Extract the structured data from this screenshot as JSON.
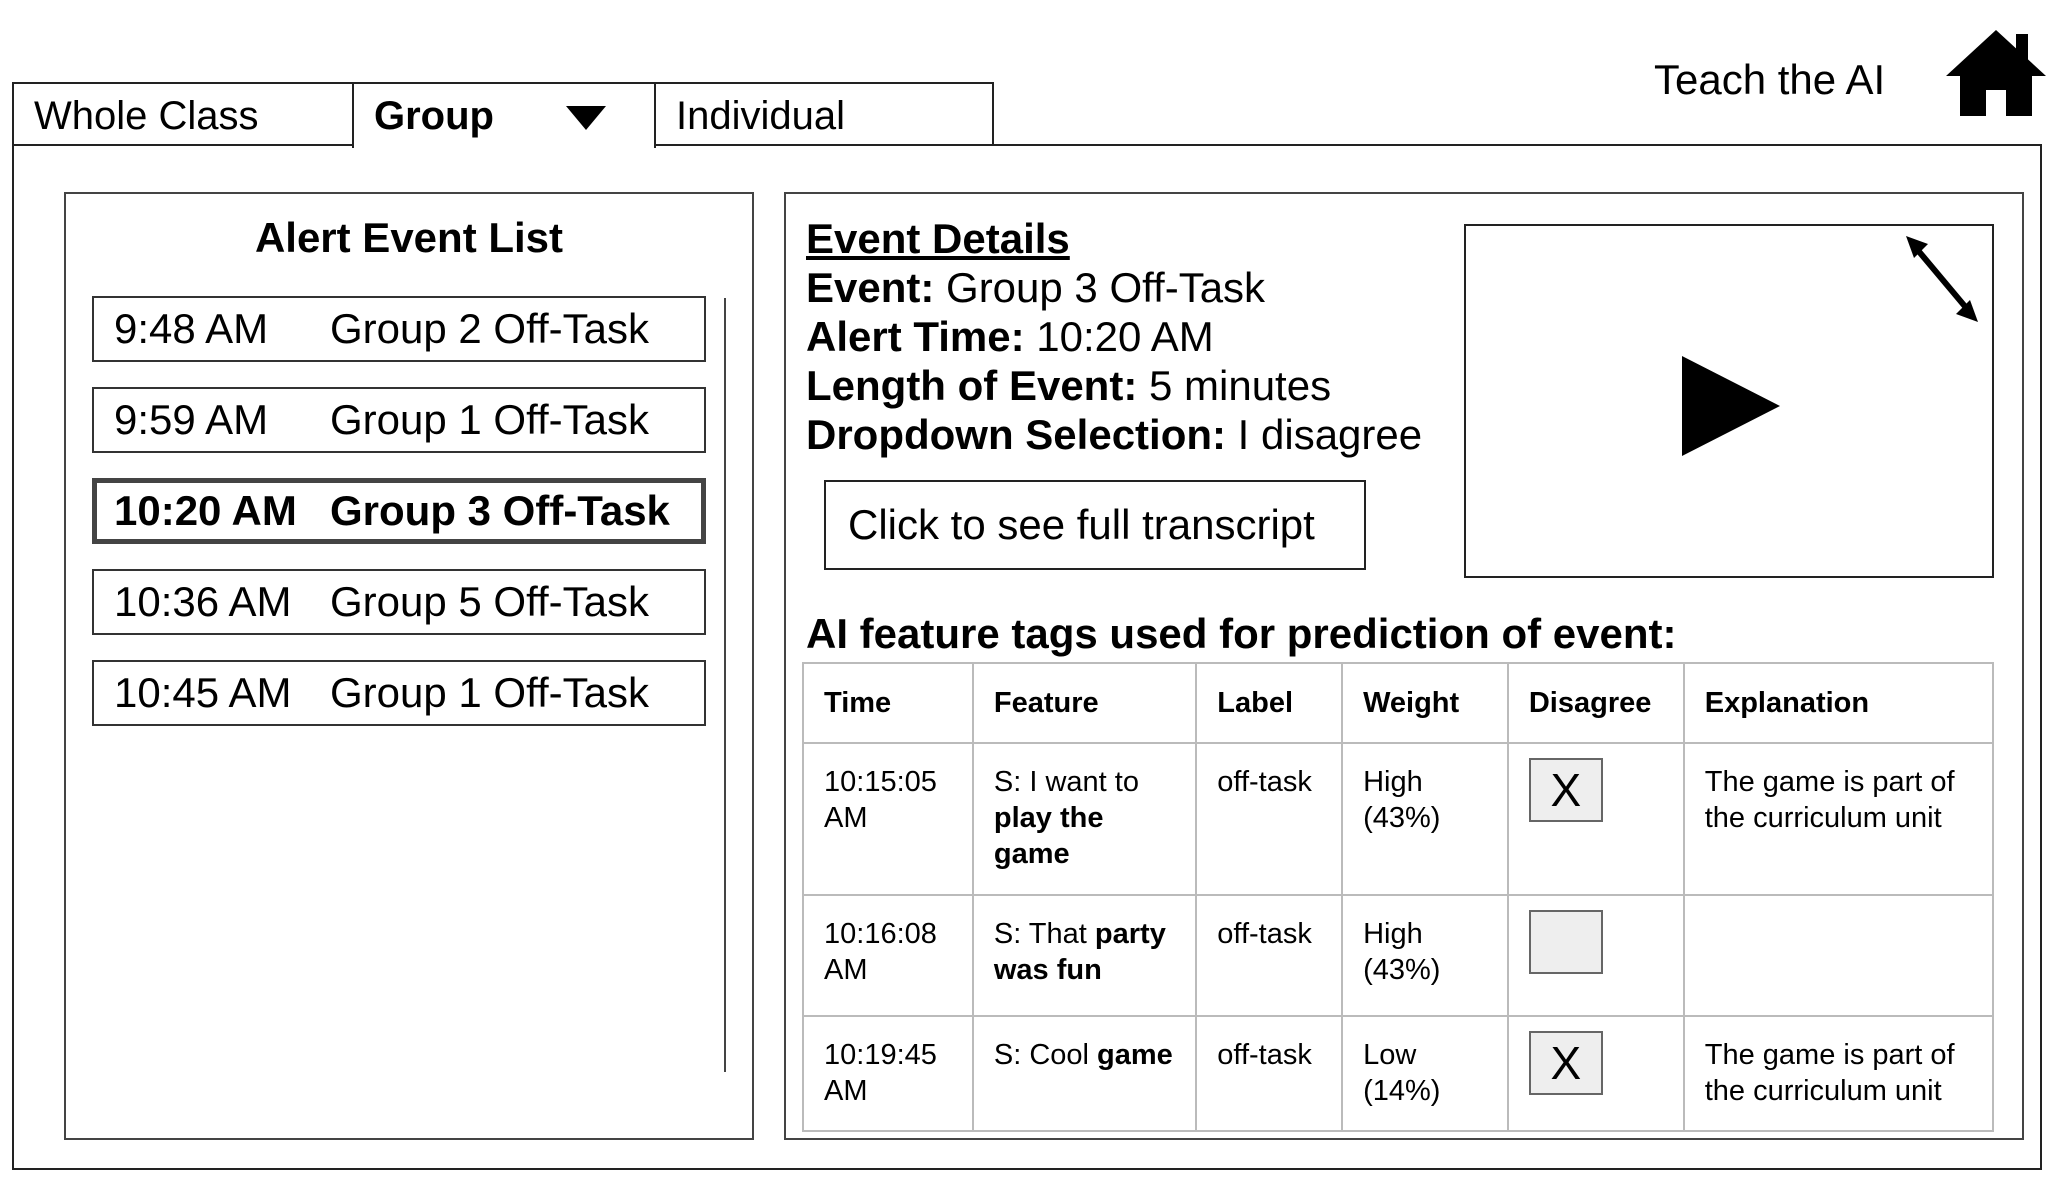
{
  "tabs": [
    {
      "label": "Whole Class",
      "active": false
    },
    {
      "label": "Group",
      "active": true,
      "has_dropdown": true
    },
    {
      "label": "Individual",
      "active": false
    }
  ],
  "header": {
    "title": "Teach  the AI",
    "home_icon": "home-icon"
  },
  "alert_list": {
    "title": "Alert Event List",
    "items": [
      {
        "time": "9:48 AM",
        "name": "Group 2 Off-Task",
        "selected": false
      },
      {
        "time": "9:59 AM",
        "name": "Group 1 Off-Task",
        "selected": false
      },
      {
        "time": "10:20 AM",
        "name": "Group 3 Off-Task",
        "selected": true
      },
      {
        "time": "10:36 AM",
        "name": "Group 5 Off-Task",
        "selected": false
      },
      {
        "time": "10:45 AM",
        "name": "Group 1 Off-Task",
        "selected": false
      }
    ]
  },
  "event_details": {
    "heading": "Event Details",
    "event_label": "Event:",
    "event_value": "Group 3 Off-Task",
    "alert_time_label": "Alert Time:",
    "alert_time_value": "10:20 AM",
    "length_label": "Length of Event:",
    "length_value": "5 minutes",
    "dropdown_label": "Dropdown Selection:",
    "dropdown_value": "I disagree",
    "transcript_button": "Click to see full transcript"
  },
  "video": {
    "play_icon": "play-icon",
    "expand_icon": "expand-icon"
  },
  "features": {
    "title": "AI feature tags used for prediction of event:",
    "columns": [
      "Time",
      "Feature",
      "Label",
      "Weight",
      "Disagree",
      "Explanation"
    ],
    "rows": [
      {
        "time": "10:15:05 AM",
        "feature_prefix": "S: I want to ",
        "feature_bold": "play the game",
        "label": "off-task",
        "weight": "High (43%)",
        "disagree": "X",
        "explanation": "The game is part of the curriculum unit"
      },
      {
        "time": "10:16:08 AM",
        "feature_prefix": "S: That ",
        "feature_bold": "party was fun",
        "label": "off-task",
        "weight": "High (43%)",
        "disagree": "",
        "explanation": ""
      },
      {
        "time": "10:19:45 AM",
        "feature_prefix": "S: Cool ",
        "feature_bold": "game",
        "label": "off-task",
        "weight": "Low (14%)",
        "disagree": "X",
        "explanation": "The game is part of the curriculum unit"
      }
    ]
  }
}
